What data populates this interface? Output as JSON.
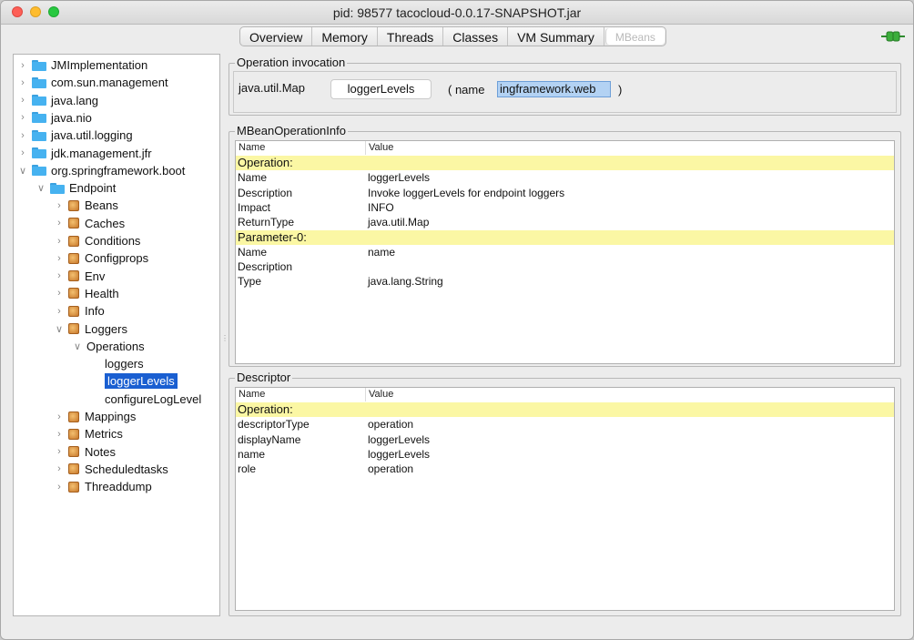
{
  "window": {
    "title": "pid: 98577 tacocloud-0.0.17-SNAPSHOT.jar"
  },
  "tabs": [
    "Overview",
    "Memory",
    "Threads",
    "Classes",
    "VM Summary",
    "MBeans"
  ],
  "tree": {
    "top_items": [
      "JMImplementation",
      "com.sun.management",
      "java.lang",
      "java.nio",
      "java.util.logging",
      "jdk.management.jfr",
      "org.springframework.boot"
    ],
    "endpoint_label": "Endpoint",
    "beans_before": [
      "Beans",
      "Caches",
      "Conditions",
      "Configprops",
      "Env",
      "Health",
      "Info",
      "Loggers"
    ],
    "operations_label": "Operations",
    "operations": [
      "loggers",
      "loggerLevels",
      "configureLogLevel"
    ],
    "beans_after": [
      "Mappings",
      "Metrics",
      "Notes",
      "Scheduledtasks",
      "Threaddump"
    ]
  },
  "invocation": {
    "title": "Operation invocation",
    "return_type": "java.util.Map",
    "button_label": "loggerLevels",
    "open_paren": "( name",
    "param_value": "ingframework.web",
    "close_paren": ")"
  },
  "mbean_info": {
    "title": "MBeanOperationInfo",
    "columns": [
      "Name",
      "Value"
    ],
    "rows": [
      {
        "name": "Operation:",
        "value": "",
        "section": true
      },
      {
        "name": "Name",
        "value": "loggerLevels"
      },
      {
        "name": "Description",
        "value": "Invoke loggerLevels for endpoint loggers"
      },
      {
        "name": "Impact",
        "value": "INFO"
      },
      {
        "name": "ReturnType",
        "value": "java.util.Map"
      },
      {
        "name": "Parameter-0:",
        "value": "",
        "section": true
      },
      {
        "name": "Name",
        "value": "name"
      },
      {
        "name": "Description",
        "value": ""
      },
      {
        "name": "Type",
        "value": "java.lang.String"
      }
    ]
  },
  "descriptor": {
    "title": "Descriptor",
    "columns": [
      "Name",
      "Value"
    ],
    "rows": [
      {
        "name": "Operation:",
        "value": "",
        "section": true
      },
      {
        "name": "descriptorType",
        "value": "operation"
      },
      {
        "name": "displayName",
        "value": "loggerLevels"
      },
      {
        "name": "name",
        "value": "loggerLevels"
      },
      {
        "name": "role",
        "value": "operation"
      }
    ]
  },
  "colors": {
    "section_highlight": "#fbf7a4",
    "selection": "#1a5fd1",
    "connect_icon": "#3cae3c"
  }
}
